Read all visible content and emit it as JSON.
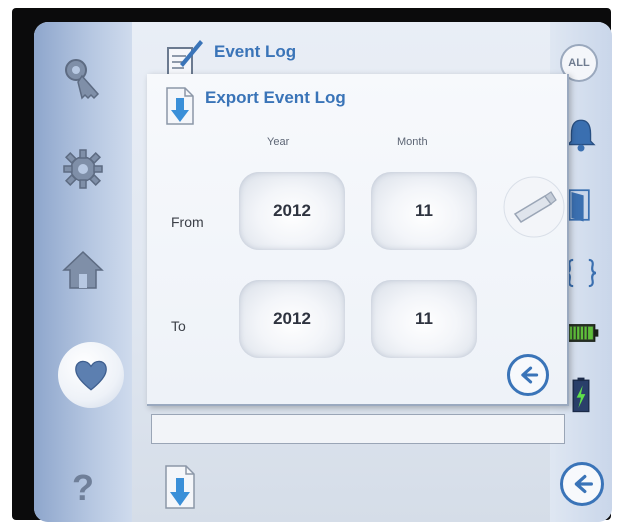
{
  "header": {
    "title": "Event Log"
  },
  "dialog": {
    "title": "Export Event Log",
    "columns": {
      "year": "Year",
      "month": "Month"
    },
    "rows": {
      "from": {
        "label": "From",
        "year": "2012",
        "month": "11"
      },
      "to": {
        "label": "To",
        "year": "2012",
        "month": "11"
      }
    }
  },
  "right_bar": {
    "all_label": "ALL"
  },
  "sidebar": {
    "items": [
      "key-icon",
      "gear-icon",
      "home-icon",
      "heart-icon",
      "help-icon"
    ]
  },
  "colors": {
    "accent": "#3a74b8",
    "sidebar": "#8ea6cc"
  }
}
